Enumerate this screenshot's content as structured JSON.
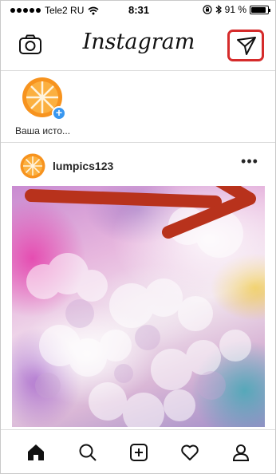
{
  "status_bar": {
    "carrier": "Tele2 RU",
    "time": "8:31",
    "battery": "91 %",
    "battery_level": 0.91
  },
  "header": {
    "logo": "Instagram",
    "camera_icon": "camera-icon",
    "direct_icon": "paper-plane-icon",
    "highlight_color": "#d52b2b"
  },
  "stories": {
    "items": [
      {
        "label": "Ваша исто...",
        "icon": "orange-slice-avatar",
        "badge": "+"
      }
    ]
  },
  "post": {
    "username": "lumpics123",
    "more_label": "•••",
    "annotation_arrow_color": "#b8321c"
  },
  "tabbar": {
    "items": [
      {
        "icon": "home-icon"
      },
      {
        "icon": "search-icon"
      },
      {
        "icon": "add-post-icon"
      },
      {
        "icon": "heart-icon"
      },
      {
        "icon": "profile-icon"
      }
    ]
  },
  "colors": {
    "accent_blue": "#3897f0",
    "orange": "#f7931e"
  }
}
